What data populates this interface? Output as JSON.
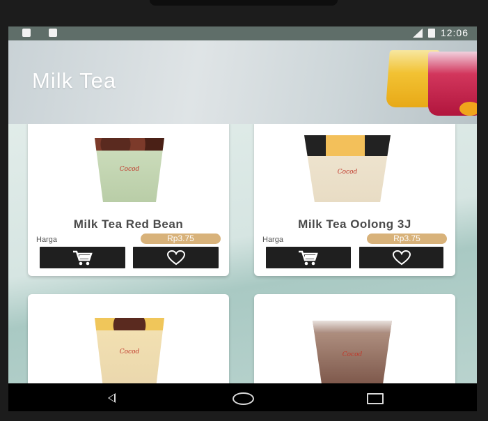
{
  "status_bar": {
    "time": "12:06",
    "icons": [
      "notification-icon",
      "android-debug-icon",
      "signal-icon",
      "battery-icon"
    ]
  },
  "header": {
    "title": "Milk Tea"
  },
  "products": [
    {
      "name": "Milk Tea Red Bean",
      "price_label": "Harga",
      "price": "Rp3.75",
      "cart_icon": "cart-icon",
      "favorite_icon": "heart-icon"
    },
    {
      "name": "Milk Tea Oolong 3J",
      "price_label": "Harga",
      "price": "Rp3.75",
      "cart_icon": "cart-icon",
      "favorite_icon": "heart-icon"
    },
    {
      "name": "",
      "price_label": "",
      "price": ""
    },
    {
      "name": "",
      "price_label": "",
      "price": ""
    }
  ],
  "colors": {
    "price_badge": "#d8b27a",
    "button": "#1f1f1f",
    "status_bar": "#5f6e69"
  },
  "nav_bar": {
    "icons": [
      "back-icon",
      "home-icon",
      "recent-apps-icon"
    ]
  }
}
